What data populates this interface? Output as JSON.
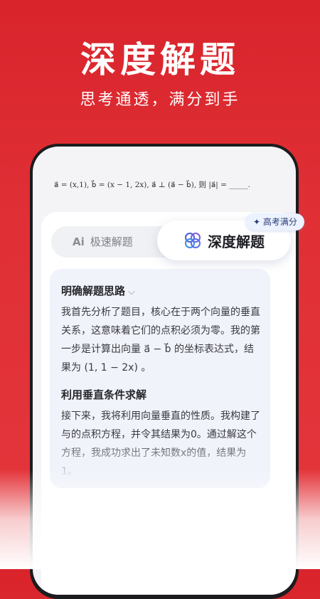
{
  "headline": "深度解题",
  "subline": "思考通透，满分到手",
  "question": "a⃗ = (x,1), b⃗ = (x − 1, 2x), a⃗ ⊥ (a⃗ − b⃗), 则 |a⃗| = _____.",
  "mode_switch": {
    "fast_icon": "Ai",
    "fast_label": "极速解题",
    "deep_icon": "brain-icon",
    "deep_label": "深度解题",
    "badge": "高考满分"
  },
  "answer_card": {
    "section1_title": "明确解题思路",
    "section1_text": "我首先分析了题目，核心在于两个向量的垂直关系，这意味着它们的点积必须为零。我的第一步是计算出向量 a⃗ − b⃗ 的坐标表达式，结果为 (1, 1 − 2x) 。",
    "section2_title": "利用垂直条件求解",
    "section2_text": "接下来，我将利用向量垂直的性质。我构建了  与的点积方程，并令其结果为0。通过解这个方程，我成功求出了未知数x的值，结果为1。"
  },
  "colors": {
    "brand_red": "#d9242c",
    "deep_accent": "#4b5fd6"
  }
}
